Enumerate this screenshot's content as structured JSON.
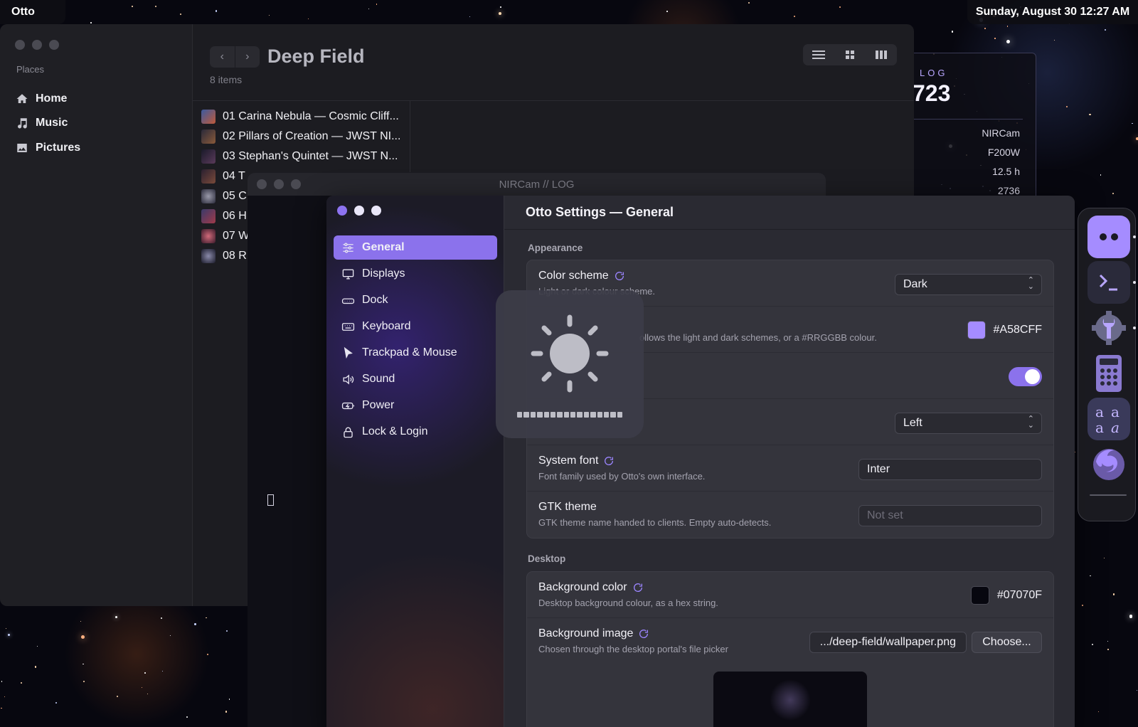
{
  "topbar": {
    "app_name": "Otto",
    "datetime": "Sunday, August 30  12:27 AM"
  },
  "file_manager": {
    "places_label": "Places",
    "places": [
      {
        "label": "Home",
        "icon": "home-icon"
      },
      {
        "label": "Music",
        "icon": "music-note-icon"
      },
      {
        "label": "Pictures",
        "icon": "image-icon"
      }
    ],
    "title": "Deep Field",
    "item_count": "8 items",
    "files": [
      {
        "label": "01 Carina Nebula — Cosmic Cliff...",
        "color": "#c05a3a"
      },
      {
        "label": "02 Pillars of Creation — JWST NI...",
        "color": "#8a5a3a"
      },
      {
        "label": "03 Stephan's Quintet — JWST N...",
        "color": "#5a3a5a"
      },
      {
        "label": "04 T",
        "color": "#7a4a3a"
      },
      {
        "label": "05 C",
        "color": "#6a6a7a"
      },
      {
        "label": "06 H",
        "color": "#7a3a4a"
      },
      {
        "label": "07 W",
        "color": "#9a4a5a"
      },
      {
        "label": "08 R",
        "color": "#4a4a6a"
      }
    ]
  },
  "log_widget": {
    "label": "LOG",
    "number": "723",
    "stats": [
      "NIRCam",
      "F200W",
      "12.5 h",
      "2736"
    ]
  },
  "nircam_window": {
    "title": "NIRCam // LOG"
  },
  "settings": {
    "title": "Otto Settings — General",
    "nav": [
      {
        "label": "General",
        "icon": "sliders-icon",
        "active": true
      },
      {
        "label": "Displays",
        "icon": "monitor-icon"
      },
      {
        "label": "Dock",
        "icon": "dock-icon"
      },
      {
        "label": "Keyboard",
        "icon": "keyboard-icon"
      },
      {
        "label": "Trackpad & Mouse",
        "icon": "pointer-icon"
      },
      {
        "label": "Sound",
        "icon": "speaker-icon"
      },
      {
        "label": "Power",
        "icon": "battery-icon"
      },
      {
        "label": "Lock & Login",
        "icon": "lock-icon"
      }
    ],
    "appearance": {
      "section_label": "Appearance",
      "color_scheme": {
        "title": "Color scheme",
        "desc": "Light or dark colour scheme.",
        "value": "Dark"
      },
      "accent": {
        "desc": "ollows the light and dark schemes, or a #RRGGBB colour.",
        "value": "#A58CFF",
        "swatch": "#A58CFF"
      },
      "toggle_on": true,
      "alignment": {
        "value": "Left"
      },
      "system_font": {
        "title": "System font",
        "desc": "Font family used by Otto's own interface.",
        "value": "Inter"
      },
      "gtk_theme": {
        "title": "GTK theme",
        "desc": "GTK theme name handed to clients. Empty auto-detects.",
        "placeholder": "Not set"
      }
    },
    "desktop": {
      "section_label": "Desktop",
      "background_color": {
        "title": "Background color",
        "desc": "Desktop background colour, as a hex string.",
        "value": "#07070F",
        "swatch": "#07070F"
      },
      "background_image": {
        "title": "Background image",
        "desc": "Chosen through the desktop portal's file picker",
        "path": ".../deep-field/wallpaper.png",
        "choose_label": "Choose..."
      }
    }
  },
  "osd": {
    "icon": "brightness-icon",
    "level": 1.0
  },
  "dock": {
    "items": [
      {
        "icon": "otto-face-icon",
        "running": true
      },
      {
        "icon": "terminal-icon",
        "running": true
      },
      {
        "icon": "settings-gear-wrench-icon",
        "running": true
      },
      {
        "icon": "calculator-icon",
        "running": false
      },
      {
        "icon": "font-viewer-icon",
        "running": false
      },
      {
        "icon": "firefox-icon",
        "running": false
      }
    ]
  }
}
